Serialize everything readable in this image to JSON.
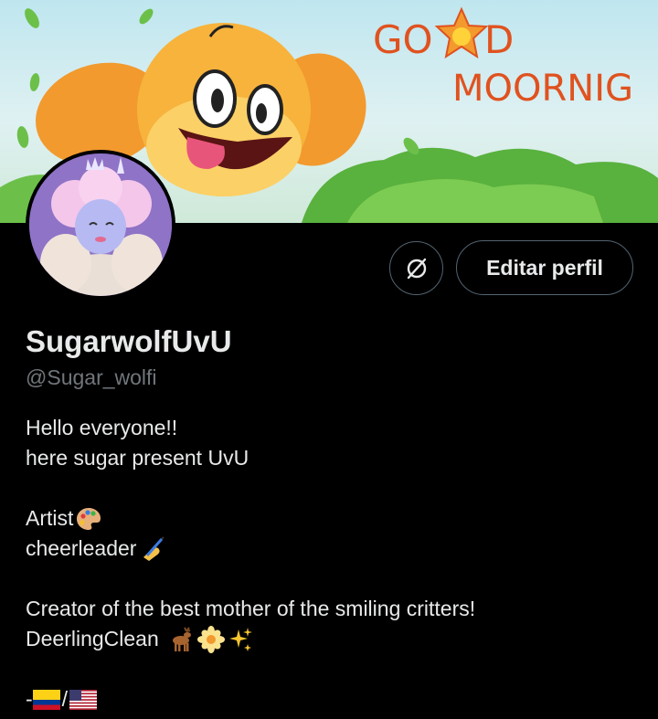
{
  "banner": {
    "text_line1": "GOOD",
    "text_line2": "MOORNIG"
  },
  "profile": {
    "display_name": "SugarwolfUvU",
    "handle": "@Sugar_wolfi",
    "edit_label": "Editar perfil"
  },
  "bio": {
    "line1": "Hello everyone!!",
    "line2": "here sugar present UvU",
    "line3": "Artist",
    "line4": "cheerleader",
    "line5": "Creator of the best mother of the smiling critters!",
    "line6": "DeerlingClean",
    "line7_prefix": "-",
    "line7_sep": "/"
  },
  "icons": {
    "banner": "dogday-cartoon-banner",
    "avatar": "pink-wolf-avatar",
    "action": "circle-slash-icon",
    "artist": "artist-palette-emoji",
    "cheer": "writing-hand-emoji",
    "deer": "deer-emoji",
    "flower": "blossom-emoji",
    "sparkles": "sparkles-emoji",
    "flag1": "colombia-flag",
    "flag2": "usa-flag"
  },
  "colors": {
    "background": "#000000",
    "text": "#e7e9ea",
    "muted": "#71767b",
    "border": "#536471",
    "banner_orange": "#f39a2a",
    "banner_title": "#e0521f"
  }
}
